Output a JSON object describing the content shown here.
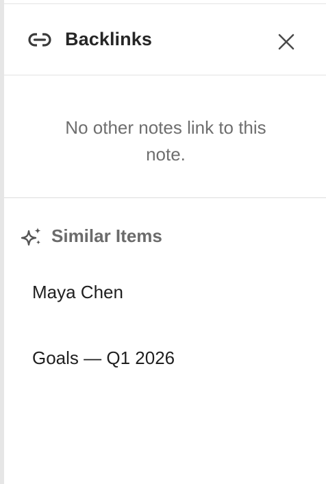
{
  "panel": {
    "title": "Backlinks",
    "close_icon": "close-icon",
    "link_icon": "link-icon"
  },
  "backlinks": {
    "empty_message": "No other notes link to this note."
  },
  "similar": {
    "icon": "sparkle-icon",
    "title": "Similar Items",
    "items": [
      {
        "label": "Maya Chen"
      },
      {
        "label": "Goals — Q1 2026"
      }
    ]
  },
  "colors": {
    "title_text": "#262626",
    "muted_text": "#6e6e6e",
    "divider": "#e2e2e2",
    "edge": "#e6e6e6"
  }
}
